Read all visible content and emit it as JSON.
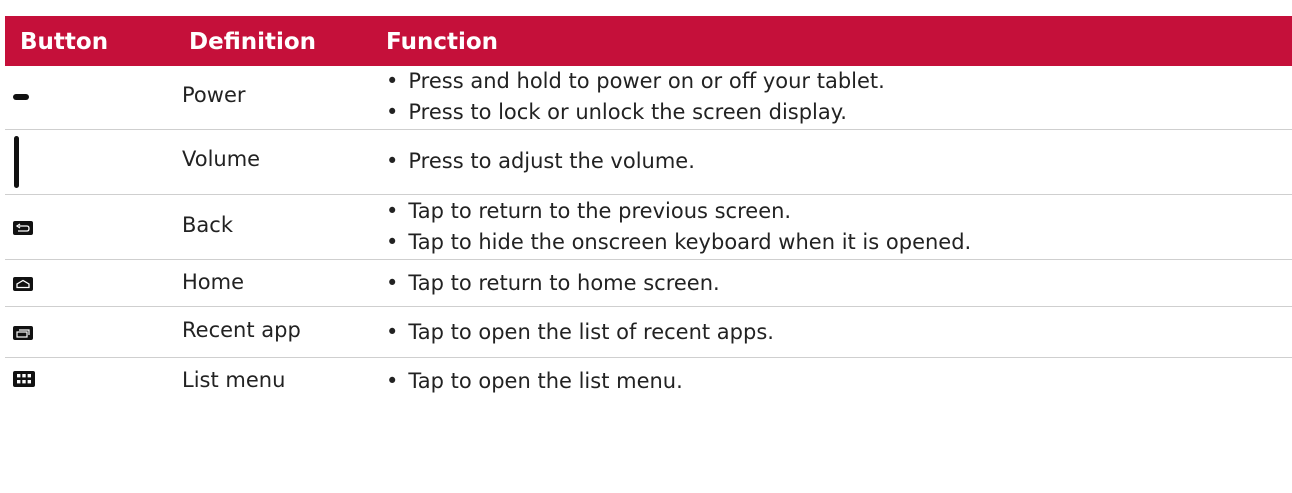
{
  "header": {
    "button": "Button",
    "definition": "Definition",
    "function": "Function"
  },
  "rows": [
    {
      "icon": "power-key-icon",
      "definition": "Power",
      "functions": [
        "Press and hold to power on or off your tablet.",
        "Press to lock or unlock the screen display."
      ]
    },
    {
      "icon": "volume-key-icon",
      "definition": "Volume",
      "functions": [
        "Press to adjust the volume."
      ]
    },
    {
      "icon": "back-icon",
      "definition": "Back",
      "functions": [
        "Tap to return to the previous screen.",
        "Tap to hide the onscreen keyboard when it is opened."
      ]
    },
    {
      "icon": "home-icon",
      "definition": "Home",
      "functions": [
        "Tap to return to home screen."
      ]
    },
    {
      "icon": "recent-apps-icon",
      "definition": "Recent app",
      "functions": [
        "Tap to open the list of recent apps."
      ]
    },
    {
      "icon": "list-menu-icon",
      "definition": "List menu",
      "functions": [
        "Tap to open the list menu."
      ]
    }
  ],
  "colors": {
    "header_bg": "#c5103a",
    "header_text": "#ffffff",
    "row_divider": "#cfcfcf"
  }
}
